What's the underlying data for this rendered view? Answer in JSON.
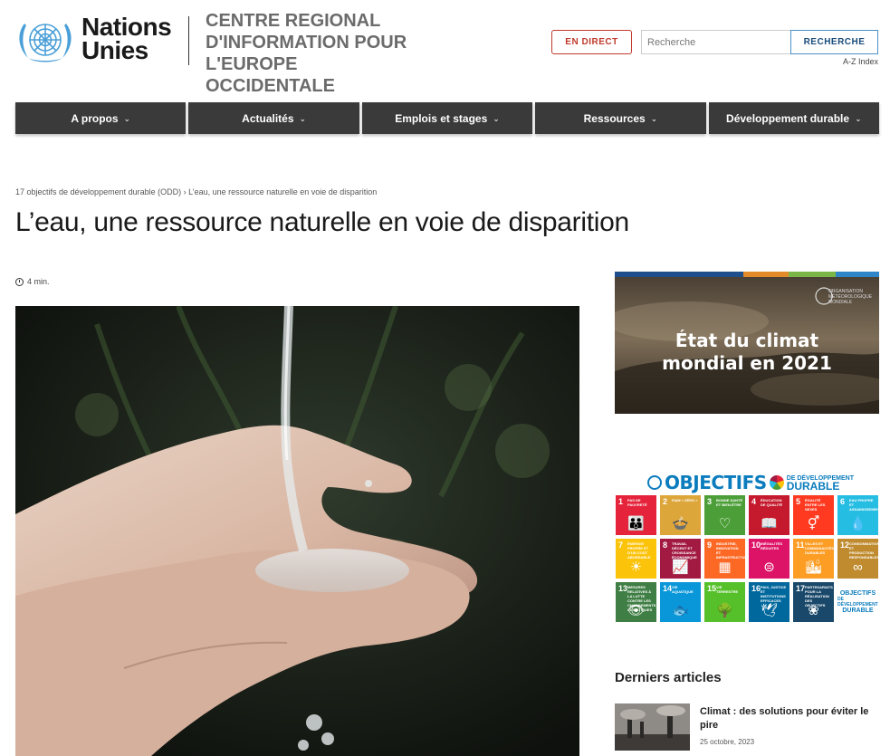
{
  "header": {
    "brand_line1": "Nations",
    "brand_line2": "Unies",
    "centre_line1": "CENTRE REGIONAL",
    "centre_line2": "D'INFORMATION POUR",
    "centre_line3": "L'EUROPE OCCIDENTALE",
    "live_button": "EN DIRECT",
    "search_placeholder": "Recherche",
    "search_button": "RECHERCHE",
    "az_index": "A-Z Index"
  },
  "nav": {
    "items": [
      {
        "label": "A propos"
      },
      {
        "label": "Actualités"
      },
      {
        "label": "Emplois et stages"
      },
      {
        "label": "Ressources"
      },
      {
        "label": "Développement durable"
      }
    ]
  },
  "breadcrumb": {
    "parent": "17 objectifs de développement durable (ODD)",
    "separator": "›",
    "current": "L’eau, une ressource naturelle en voie de disparition"
  },
  "article": {
    "title": "L’eau, une ressource naturelle en voie de disparition",
    "read_time": "4 min."
  },
  "sidebar": {
    "climate_banner": {
      "line1": "État du climat",
      "line2": "mondial en 2021",
      "org": "ORGANISATION MÉTÉOROLOGIQUE MONDIALE"
    },
    "sdg": {
      "heading": "OBJECTIFS",
      "heading_small": "DE DÉVELOPPEMENT",
      "heading_big": "DURABLE",
      "tiles": [
        {
          "num": "1",
          "label": "Pas de pauvreté",
          "color": "#e5243b",
          "icon": "👪"
        },
        {
          "num": "2",
          "label": "Faim « zéro »",
          "color": "#dda63a",
          "icon": "🍲"
        },
        {
          "num": "3",
          "label": "Bonne santé et bien-être",
          "color": "#4c9f38",
          "icon": "♡"
        },
        {
          "num": "4",
          "label": "Éducation de qualité",
          "color": "#c5192d",
          "icon": "📖"
        },
        {
          "num": "5",
          "label": "Égalité entre les sexes",
          "color": "#ff3a21",
          "icon": "⚥"
        },
        {
          "num": "6",
          "label": "Eau propre et assainissement",
          "color": "#26bde2",
          "icon": "💧"
        },
        {
          "num": "7",
          "label": "Énergie propre et d'un coût abordable",
          "color": "#fcc30b",
          "icon": "☀"
        },
        {
          "num": "8",
          "label": "Travail décent et croissance économique",
          "color": "#a21942",
          "icon": "📈"
        },
        {
          "num": "9",
          "label": "Industrie, innovation et infrastructure",
          "color": "#fd6925",
          "icon": "▦"
        },
        {
          "num": "10",
          "label": "Inégalités réduites",
          "color": "#dd1367",
          "icon": "⊜"
        },
        {
          "num": "11",
          "label": "Villes et communautés durables",
          "color": "#fd9d24",
          "icon": "🏙"
        },
        {
          "num": "12",
          "label": "Consommation et production responsables",
          "color": "#bf8b2e",
          "icon": "∞"
        },
        {
          "num": "13",
          "label": "Mesures relatives à la lutte contre les changements climatiques",
          "color": "#3f7e44",
          "icon": "👁"
        },
        {
          "num": "14",
          "label": "Vie aquatique",
          "color": "#0a97d9",
          "icon": "🐟"
        },
        {
          "num": "15",
          "label": "Vie terrestre",
          "color": "#56c02b",
          "icon": "🌳"
        },
        {
          "num": "16",
          "label": "Paix, justice et institutions efficaces",
          "color": "#00689d",
          "icon": "🕊"
        },
        {
          "num": "17",
          "label": "Partenariats pour la réalisation des objectifs",
          "color": "#19486a",
          "icon": "❀"
        }
      ],
      "logo_tile_a": "OBJECTIFS",
      "logo_tile_b": "DE DÉVELOPPEMENT",
      "logo_tile_c": "DURABLE"
    },
    "latest": {
      "heading": "Derniers articles",
      "items": [
        {
          "title": "Climat : des solutions pour éviter le pire",
          "date": "25 octobre, 2023"
        }
      ]
    }
  }
}
